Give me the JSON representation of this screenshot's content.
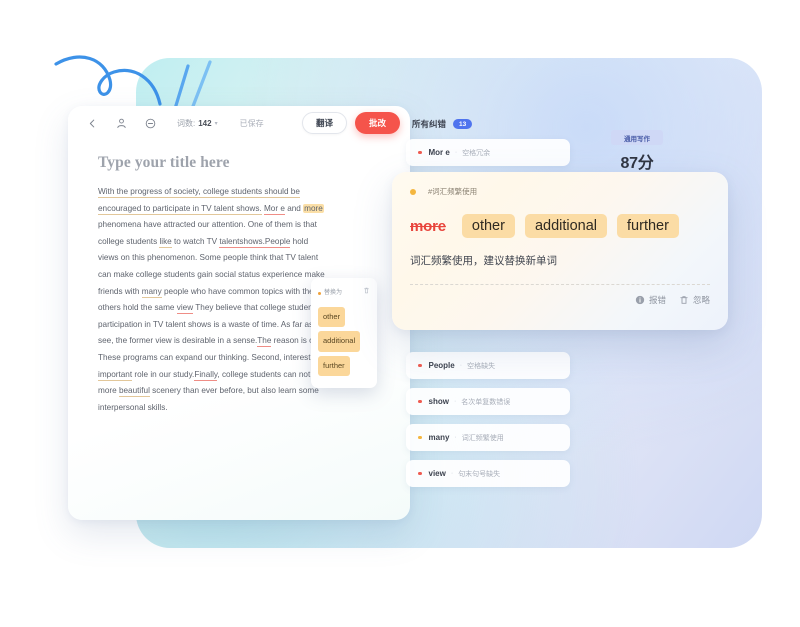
{
  "editor": {
    "toolbar": {
      "back_icon": "chevron-left-icon",
      "user_icon": "person-icon",
      "minus_icon": "minus-circle-icon",
      "wordcount_label": "词数:",
      "wordcount_value": "142",
      "saved_label": "已保存",
      "translate_label": "翻译",
      "correct_label": "批改"
    },
    "title_placeholder": "Type your title here",
    "body_lines": [
      "With the progress of society, college students should be",
      "encouraged to participate in TV talent shows. Mor e and more",
      "phenomena have attracted our attention. One of them is that",
      "college students like to watch TV talentshows.People hold",
      "views on this phenomenon. Some people think that TV talent",
      "can make college students gain social status experience make",
      "friends with many people who have common topics with them,",
      "others hold the same view They believe that college students'",
      "participation in TV talent shows is a waste of time. As far as I can",
      "see, the former view is desirable in a sense.The reason is obvious.",
      "These programs can expand our thinking. Second, interest plays an",
      "important role in our study.Finally, college students can not only see",
      "more beautiful scenery than ever before, but also learn some",
      "interpersonal skills."
    ],
    "replace_popup": {
      "header": "替换为",
      "delete_icon": "trash-icon",
      "options": [
        "other",
        "additional",
        "further"
      ]
    }
  },
  "panel": {
    "title": "所有纠错",
    "badge": "13",
    "score_tag": "通用写作",
    "score_value": "87分",
    "errors": [
      {
        "word": "Mor e",
        "type": "空格冗余",
        "color": "#ef5b50"
      },
      {
        "word": "People",
        "type": "空格缺失",
        "color": "#ef5b50"
      },
      {
        "word": "show",
        "type": "名次单复数错误",
        "color": "#ef5b50"
      },
      {
        "word": "many",
        "type": "词汇频繁使用",
        "color": "#f4b63f"
      },
      {
        "word": "view",
        "type": "句末句号缺失",
        "color": "#ef5b50"
      }
    ]
  },
  "suggestion_card": {
    "bullet_icon": "dot-icon",
    "tag": "#词汇频繁使用",
    "wrong_word": "more",
    "options": [
      "other",
      "additional",
      "further"
    ],
    "description": "词汇频繁使用，建议替换新单词",
    "report_icon": "info-icon",
    "report_label": "报错",
    "ignore_icon": "trash-icon",
    "ignore_label": "忽略"
  },
  "colors": {
    "accent_red": "#f5544b",
    "accent_blue": "#4f74ee",
    "highlight_amber": "#fbdca5"
  }
}
